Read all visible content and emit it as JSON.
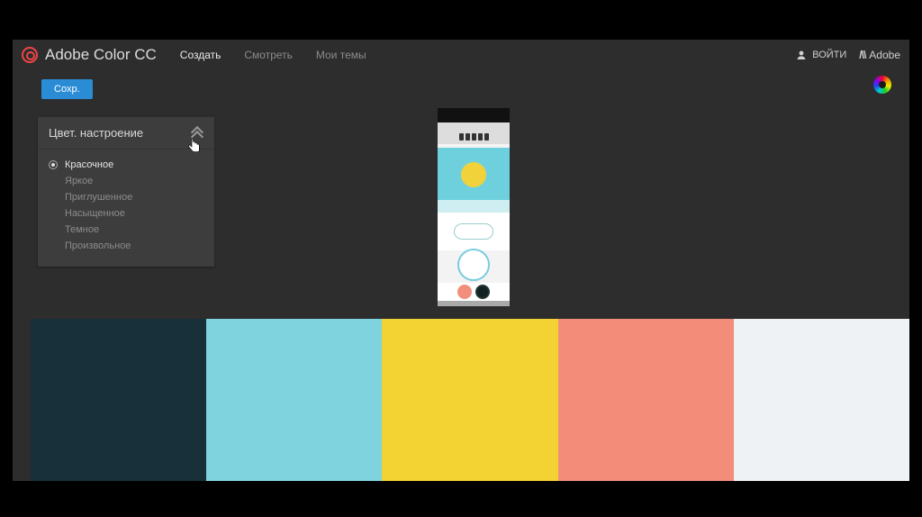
{
  "header": {
    "brand": "Adobe Color CC",
    "nav": {
      "create": "Создать",
      "explore": "Смотреть",
      "mythemes": "Мои темы"
    },
    "login": "ВОЙТИ",
    "adobe": "Adobe"
  },
  "toolbar": {
    "save": "Сохр."
  },
  "mood_panel": {
    "title": "Цвет. настроение",
    "options": [
      {
        "label": "Красочное",
        "selected": true
      },
      {
        "label": "Яркое",
        "selected": false
      },
      {
        "label": "Приглушенное",
        "selected": false
      },
      {
        "label": "Насыщенное",
        "selected": false
      },
      {
        "label": "Темное",
        "selected": false
      },
      {
        "label": "Произвольное",
        "selected": false
      }
    ]
  },
  "palette": {
    "swatches": [
      "#18303a",
      "#7fd3de",
      "#f3d233",
      "#f38c79",
      "#eef2f4"
    ]
  }
}
